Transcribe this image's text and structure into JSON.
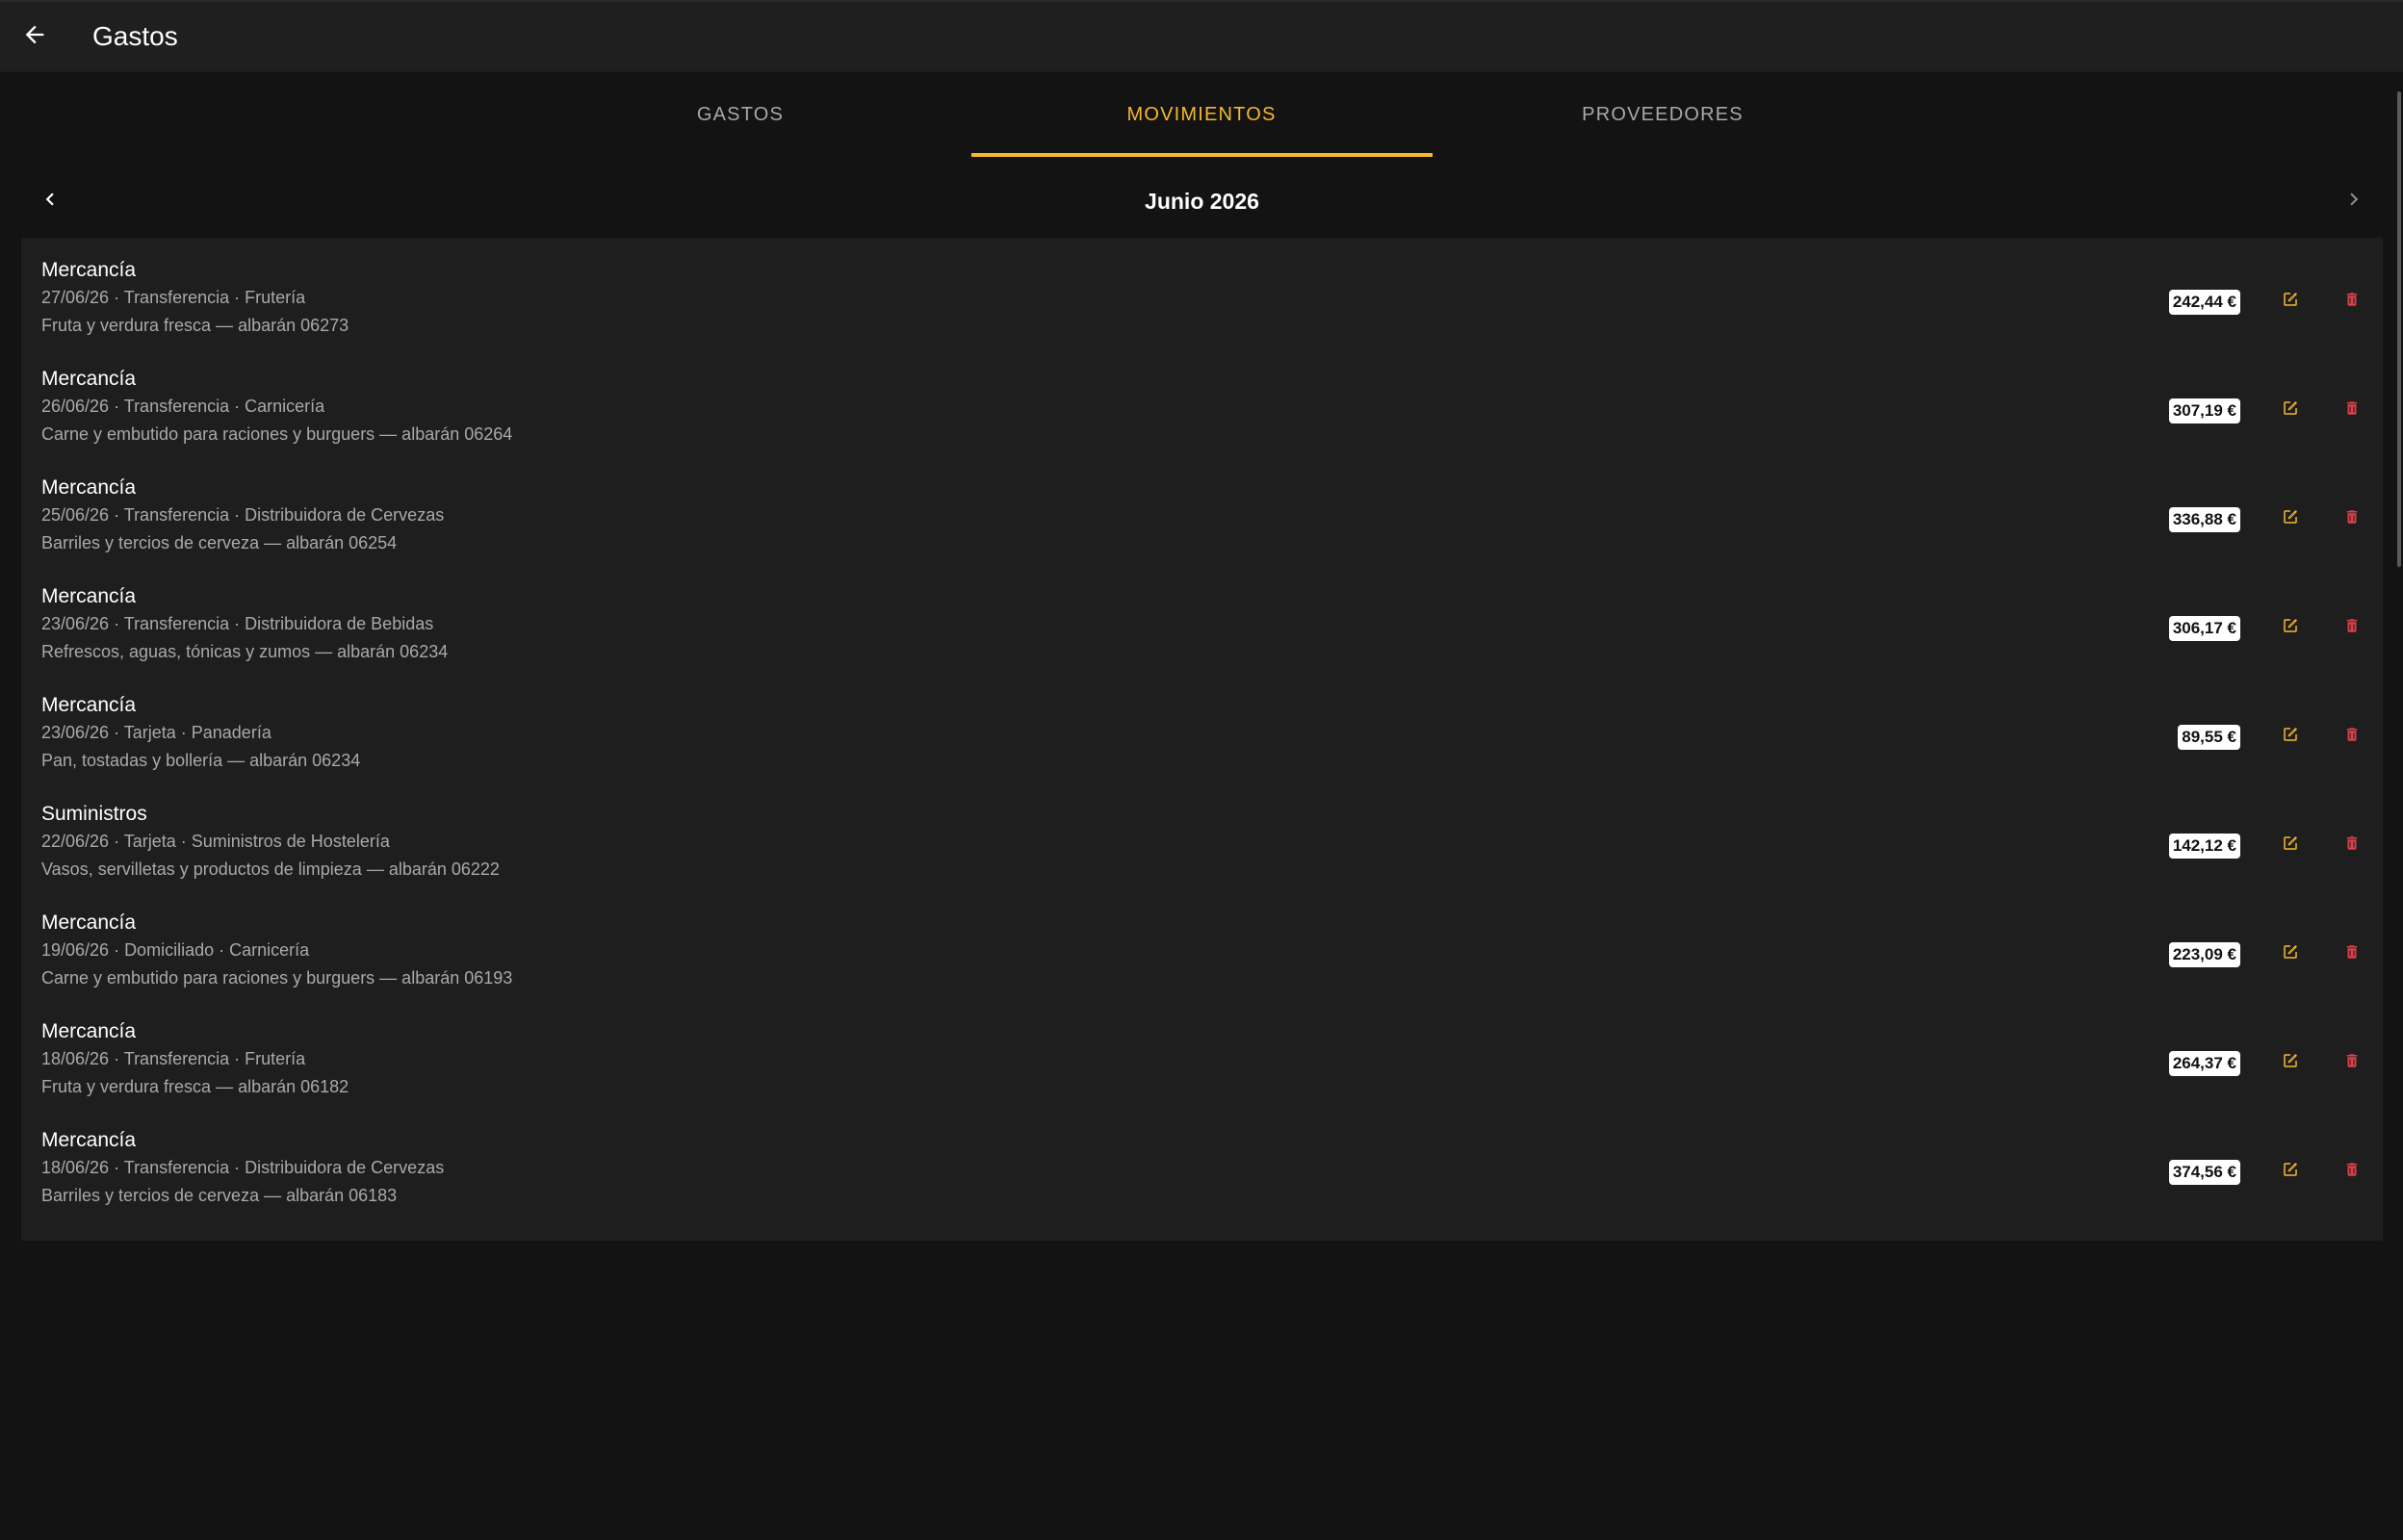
{
  "appbar": {
    "title": "Gastos",
    "back_icon": "arrow-back-icon"
  },
  "tabs": [
    {
      "label": "GASTOS",
      "active": false
    },
    {
      "label": "MOVIMIENTOS",
      "active": true
    },
    {
      "label": "PROVEEDORES",
      "active": false
    }
  ],
  "month": {
    "label": "Junio 2026",
    "prev_icon": "chevron-left-icon",
    "next_icon": "chevron-right-icon"
  },
  "colors": {
    "accent": "#f5b82e",
    "delete": "#d9414a",
    "background": "#131313",
    "surface": "#1e1e1e"
  },
  "movements": [
    {
      "title": "Mercancía",
      "meta": "27/06/26 · Transferencia · Frutería",
      "desc": "Fruta y verdura fresca — albarán 06273",
      "amount": "242,44 €"
    },
    {
      "title": "Mercancía",
      "meta": "26/06/26 · Transferencia · Carnicería",
      "desc": "Carne y embutido para raciones y burguers — albarán 06264",
      "amount": "307,19 €"
    },
    {
      "title": "Mercancía",
      "meta": "25/06/26 · Transferencia · Distribuidora de Cervezas",
      "desc": "Barriles y tercios de cerveza — albarán 06254",
      "amount": "336,88 €"
    },
    {
      "title": "Mercancía",
      "meta": "23/06/26 · Transferencia · Distribuidora de Bebidas",
      "desc": "Refrescos, aguas, tónicas y zumos — albarán 06234",
      "amount": "306,17 €"
    },
    {
      "title": "Mercancía",
      "meta": "23/06/26 · Tarjeta · Panadería",
      "desc": "Pan, tostadas y bollería — albarán 06234",
      "amount": "89,55 €"
    },
    {
      "title": "Suministros",
      "meta": "22/06/26 · Tarjeta · Suministros de Hostelería",
      "desc": "Vasos, servilletas y productos de limpieza — albarán 06222",
      "amount": "142,12 €"
    },
    {
      "title": "Mercancía",
      "meta": "19/06/26 · Domiciliado · Carnicería",
      "desc": "Carne y embutido para raciones y burguers — albarán 06193",
      "amount": "223,09 €"
    },
    {
      "title": "Mercancía",
      "meta": "18/06/26 · Transferencia · Frutería",
      "desc": "Fruta y verdura fresca — albarán 06182",
      "amount": "264,37 €"
    },
    {
      "title": "Mercancía",
      "meta": "18/06/26 · Transferencia · Distribuidora de Cervezas",
      "desc": "Barriles y tercios de cerveza — albarán 06183",
      "amount": "374,56 €"
    }
  ]
}
